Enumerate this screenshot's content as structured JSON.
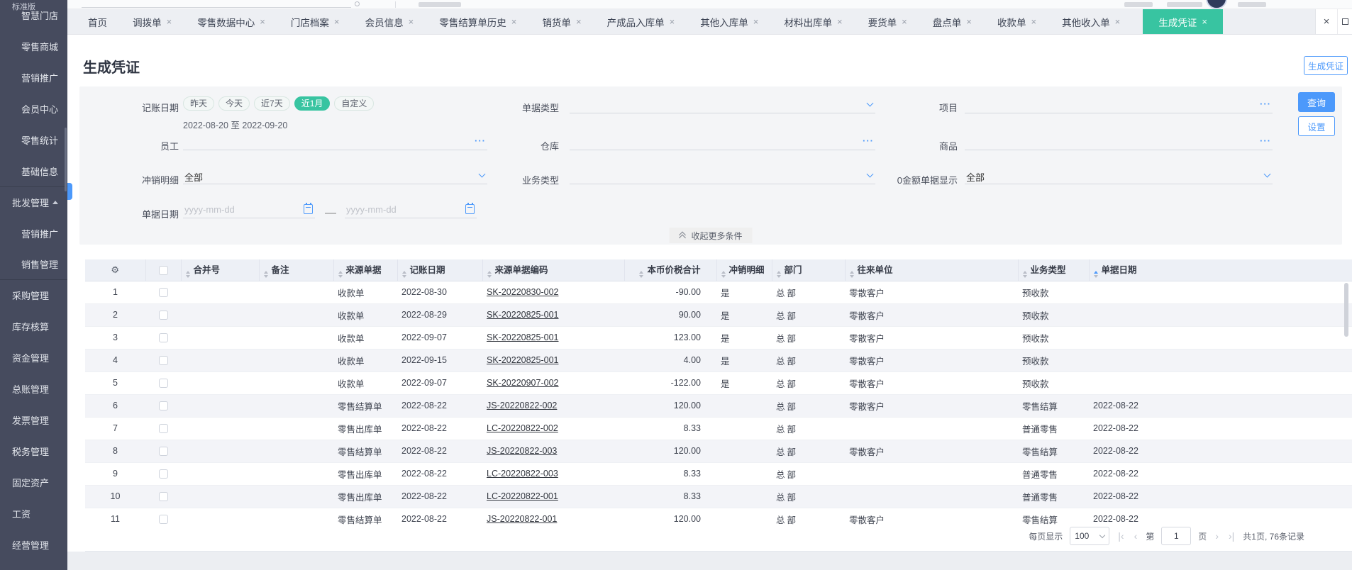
{
  "topbar": {
    "edition": "标准版"
  },
  "sidebar": {
    "items": [
      {
        "label": "智慧门店",
        "level": "child"
      },
      {
        "label": "零售商城",
        "level": "child"
      },
      {
        "label": "营销推广",
        "level": "child"
      },
      {
        "label": "会员中心",
        "level": "child"
      },
      {
        "label": "零售统计",
        "level": "child"
      },
      {
        "label": "基础信息",
        "level": "child"
      },
      {
        "label": "批发管理",
        "level": "group",
        "expanded": true,
        "section_start": true
      },
      {
        "label": "营销推广",
        "level": "child"
      },
      {
        "label": "销售管理",
        "level": "child",
        "section_end": true
      },
      {
        "label": "采购管理",
        "level": "group"
      },
      {
        "label": "库存核算",
        "level": "group"
      },
      {
        "label": "资金管理",
        "level": "group"
      },
      {
        "label": "总账管理",
        "level": "group"
      },
      {
        "label": "发票管理",
        "level": "group"
      },
      {
        "label": "税务管理",
        "level": "group"
      },
      {
        "label": "固定资产",
        "level": "group"
      },
      {
        "label": "工资",
        "level": "group"
      },
      {
        "label": "经营管理",
        "level": "group"
      }
    ]
  },
  "tabbar": {
    "tabs": [
      {
        "label": "首页",
        "closable": false
      },
      {
        "label": "调拨单",
        "closable": true
      },
      {
        "label": "零售数据中心",
        "closable": true
      },
      {
        "label": "门店档案",
        "closable": true
      },
      {
        "label": "会员信息",
        "closable": true
      },
      {
        "label": "零售结算单历史",
        "closable": true
      },
      {
        "label": "销货单",
        "closable": true
      },
      {
        "label": "产成品入库单",
        "closable": true
      },
      {
        "label": "其他入库单",
        "closable": true
      },
      {
        "label": "材料出库单",
        "closable": true
      },
      {
        "label": "要货单",
        "closable": true
      },
      {
        "label": "盘点单",
        "closable": true
      },
      {
        "label": "收款单",
        "closable": true
      },
      {
        "label": "其他收入单",
        "closable": true
      },
      {
        "label": "生成凭证",
        "closable": true,
        "active": true
      }
    ],
    "close_all": "×"
  },
  "page": {
    "title": "生成凭证",
    "generate_button": "生成凭证"
  },
  "filters": {
    "booking_date": {
      "label": "记账日期",
      "pills": [
        "昨天",
        "今天",
        "近7天",
        "近1月",
        "自定义"
      ],
      "active_pill": "近1月",
      "range": "2022-08-20 至 2022-09-20"
    },
    "doc_type_label": "单据类型",
    "project_label": "项目",
    "employee_label": "员工",
    "warehouse_label": "仓库",
    "goods_label": "商品",
    "writeoff_label": "冲销明细",
    "writeoff_value": "全部",
    "business_type_label": "业务类型",
    "zero_amount_label": "0金额单据显示",
    "zero_amount_value": "全部",
    "doc_date_label": "单据日期",
    "date_placeholder": "yyyy-mm-dd",
    "date_separator": "—",
    "collapse_label": "收起更多条件",
    "query_button": "查询",
    "settings_button": "设置"
  },
  "table": {
    "columns": [
      "合并号",
      "备注",
      "来源单据",
      "记账日期",
      "来源单据编码",
      "本币价税合计",
      "冲销明细",
      "部门",
      "往来单位",
      "业务类型",
      "单据日期"
    ],
    "sorted_column": "单据日期",
    "right_aligned_column": "本币价税合计",
    "rows": [
      {
        "num": "1",
        "merge_no": "",
        "remark": "",
        "source": "收款单",
        "booking_date": "2022-08-30",
        "source_code": "SK-20220830-002",
        "amount": "-90.00",
        "writeoff": "是",
        "dept": "总部",
        "partner": "零散客户",
        "biz_type": "预收款",
        "doc_date": ""
      },
      {
        "num": "2",
        "merge_no": "",
        "remark": "",
        "source": "收款单",
        "booking_date": "2022-08-29",
        "source_code": "SK-20220825-001",
        "amount": "90.00",
        "writeoff": "是",
        "dept": "总部",
        "partner": "零散客户",
        "biz_type": "预收款",
        "doc_date": ""
      },
      {
        "num": "3",
        "merge_no": "",
        "remark": "",
        "source": "收款单",
        "booking_date": "2022-09-07",
        "source_code": "SK-20220825-001",
        "amount": "123.00",
        "writeoff": "是",
        "dept": "总部",
        "partner": "零散客户",
        "biz_type": "预收款",
        "doc_date": ""
      },
      {
        "num": "4",
        "merge_no": "",
        "remark": "",
        "source": "收款单",
        "booking_date": "2022-09-15",
        "source_code": "SK-20220825-001",
        "amount": "4.00",
        "writeoff": "是",
        "dept": "总部",
        "partner": "零散客户",
        "biz_type": "预收款",
        "doc_date": ""
      },
      {
        "num": "5",
        "merge_no": "",
        "remark": "",
        "source": "收款单",
        "booking_date": "2022-09-07",
        "source_code": "SK-20220907-002",
        "amount": "-122.00",
        "writeoff": "是",
        "dept": "总部",
        "partner": "零散客户",
        "biz_type": "预收款",
        "doc_date": ""
      },
      {
        "num": "6",
        "merge_no": "",
        "remark": "",
        "source": "零售结算单",
        "booking_date": "2022-08-22",
        "source_code": "JS-20220822-002",
        "amount": "120.00",
        "writeoff": "",
        "dept": "总部",
        "partner": "零散客户",
        "biz_type": "零售结算",
        "doc_date": "2022-08-22"
      },
      {
        "num": "7",
        "merge_no": "",
        "remark": "",
        "source": "零售出库单",
        "booking_date": "2022-08-22",
        "source_code": "LC-20220822-002",
        "amount": "8.33",
        "writeoff": "",
        "dept": "总部",
        "partner": "",
        "biz_type": "普通零售",
        "doc_date": "2022-08-22"
      },
      {
        "num": "8",
        "merge_no": "",
        "remark": "",
        "source": "零售结算单",
        "booking_date": "2022-08-22",
        "source_code": "JS-20220822-003",
        "amount": "120.00",
        "writeoff": "",
        "dept": "总部",
        "partner": "零散客户",
        "biz_type": "零售结算",
        "doc_date": "2022-08-22"
      },
      {
        "num": "9",
        "merge_no": "",
        "remark": "",
        "source": "零售出库单",
        "booking_date": "2022-08-22",
        "source_code": "LC-20220822-003",
        "amount": "8.33",
        "writeoff": "",
        "dept": "总部",
        "partner": "",
        "biz_type": "普通零售",
        "doc_date": "2022-08-22"
      },
      {
        "num": "10",
        "merge_no": "",
        "remark": "",
        "source": "零售出库单",
        "booking_date": "2022-08-22",
        "source_code": "LC-20220822-001",
        "amount": "8.33",
        "writeoff": "",
        "dept": "总部",
        "partner": "",
        "biz_type": "普通零售",
        "doc_date": "2022-08-22"
      },
      {
        "num": "11",
        "merge_no": "",
        "remark": "",
        "source": "零售结算单",
        "booking_date": "2022-08-22",
        "source_code": "JS-20220822-001",
        "amount": "120.00",
        "writeoff": "",
        "dept": "总部",
        "partner": "零散客户",
        "biz_type": "零售结算",
        "doc_date": "2022-08-22"
      }
    ]
  },
  "pagination": {
    "per_page_label": "每页显示",
    "per_page_value": "100",
    "first_icon": "|‹",
    "prev_icon": "‹",
    "page_prefix": "第",
    "page_value": "1",
    "page_suffix": "页",
    "next_icon": "›",
    "last_icon": "›|",
    "total": "共1页, 76条记录"
  },
  "colors": {
    "accent_teal": "#38c4a1",
    "accent_blue": "#4c99fb",
    "sidebar_bg": "#464b5e"
  }
}
